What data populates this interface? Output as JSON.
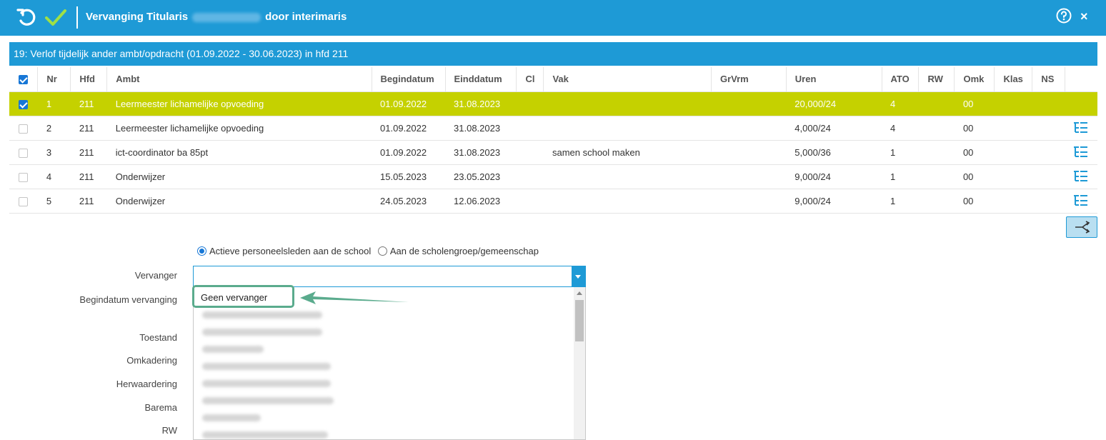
{
  "header": {
    "title_prefix": "Vervanging Titularis",
    "title_suffix": "door interimaris",
    "close_glyph": "×",
    "icons": [
      "undo-icon",
      "check-icon",
      "help-icon",
      "close-icon"
    ],
    "color": "#1e9ad6"
  },
  "section": {
    "title": "19: Verlof tijdelijk ander ambt/opdracht (01.09.2022 - 30.06.2023) in hfd 211"
  },
  "table": {
    "columns": [
      "Nr",
      "Hfd",
      "Ambt",
      "Begindatum",
      "Einddatum",
      "Cl",
      "Vak",
      "GrVrm",
      "Uren",
      "ATO",
      "RW",
      "Omk",
      "Klas",
      "NS"
    ],
    "rows": [
      {
        "nr": "1",
        "hfd": "211",
        "ambt": "Leermeester lichamelijke opvoeding",
        "begin": "01.09.2022",
        "eind": "31.08.2023",
        "cl": "",
        "vak": "",
        "grvrm": "",
        "uren": "20,000/24",
        "ato": "4",
        "rw": "",
        "omk": "00",
        "klas": "",
        "ns": "",
        "checked": true,
        "selected": true
      },
      {
        "nr": "2",
        "hfd": "211",
        "ambt": "Leermeester lichamelijke opvoeding",
        "begin": "01.09.2022",
        "eind": "31.08.2023",
        "cl": "",
        "vak": "",
        "grvrm": "",
        "uren": "4,000/24",
        "ato": "4",
        "rw": "",
        "omk": "00",
        "klas": "",
        "ns": "",
        "checked": false,
        "selected": false
      },
      {
        "nr": "3",
        "hfd": "211",
        "ambt": "ict-coordinator ba 85pt",
        "begin": "01.09.2022",
        "eind": "31.08.2023",
        "cl": "",
        "vak": "samen school maken",
        "grvrm": "",
        "uren": "5,000/36",
        "ato": "1",
        "rw": "",
        "omk": "00",
        "klas": "",
        "ns": "",
        "checked": false,
        "selected": false
      },
      {
        "nr": "4",
        "hfd": "211",
        "ambt": "Onderwijzer",
        "begin": "15.05.2023",
        "eind": "23.05.2023",
        "cl": "",
        "vak": "",
        "grvrm": "",
        "uren": "9,000/24",
        "ato": "1",
        "rw": "",
        "omk": "00",
        "klas": "",
        "ns": "",
        "checked": false,
        "selected": false
      },
      {
        "nr": "5",
        "hfd": "211",
        "ambt": "Onderwijzer",
        "begin": "24.05.2023",
        "eind": "12.06.2023",
        "cl": "",
        "vak": "",
        "grvrm": "",
        "uren": "9,000/24",
        "ato": "1",
        "rw": "",
        "omk": "00",
        "klas": "",
        "ns": "",
        "checked": false,
        "selected": false
      }
    ],
    "selected_color": "#c5d100"
  },
  "form": {
    "radio_active": "Actieve personeelsleden aan de school",
    "radio_group": "Aan de scholengroep/gemeenschap",
    "labels": {
      "vervanger": "Vervanger",
      "begindatum": "Begindatum vervanging",
      "toestand": "Toestand",
      "omkadering": "Omkadering",
      "herwaardering": "Herwaardering",
      "barema": "Barema",
      "rw": "RW"
    },
    "vervanger_value": "",
    "dropdown_first_option": "Geen vervanger"
  },
  "annotation_color": "#5aab8d"
}
